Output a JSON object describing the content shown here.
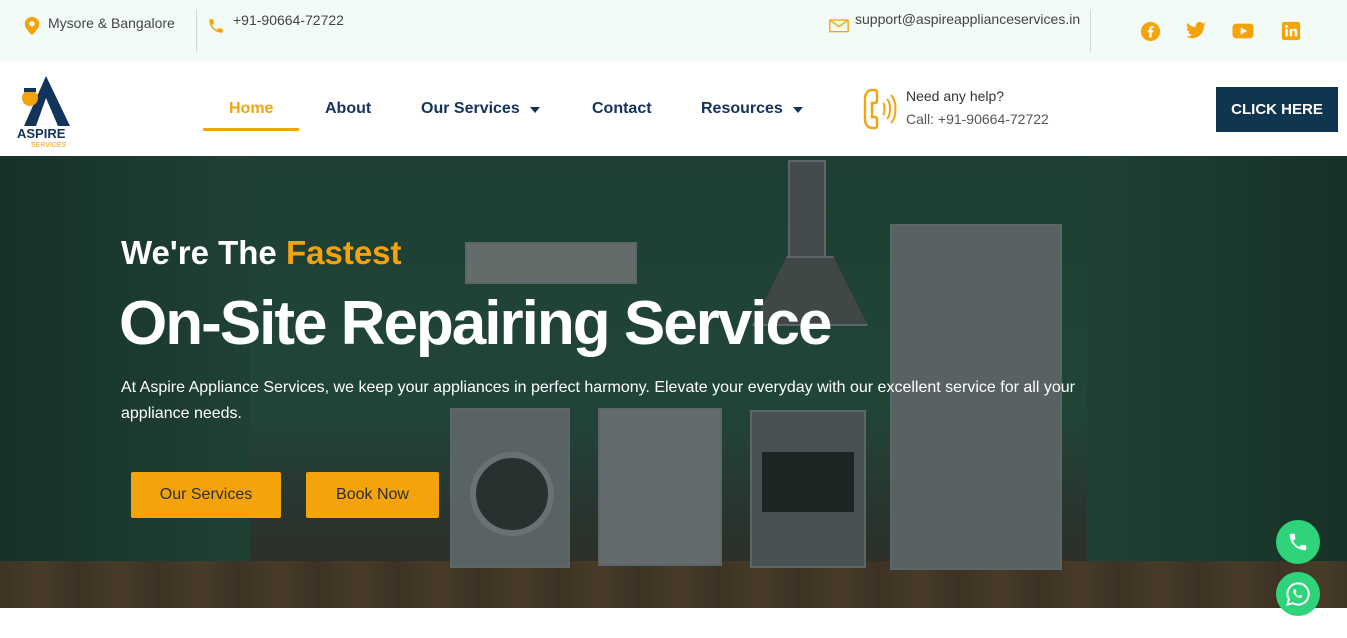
{
  "topbar": {
    "location": "Mysore & Bangalore",
    "phone": "+91-90664-72722",
    "email": "support@aspireapplianceservices.in",
    "social": [
      "facebook-icon",
      "twitter-icon",
      "youtube-icon",
      "linkedin-icon"
    ]
  },
  "logo": {
    "brand": "ASPIRE",
    "tagline": "SERVICES"
  },
  "nav": {
    "items": [
      {
        "label": "Home",
        "active": true
      },
      {
        "label": "About"
      },
      {
        "label": "Our Services",
        "dropdown": true
      },
      {
        "label": "Contact"
      },
      {
        "label": "Resources",
        "dropdown": true
      }
    ]
  },
  "help": {
    "title": "Need any help?",
    "call": "Call: +91-90664-72722"
  },
  "cta_label": "CLICK HERE",
  "hero": {
    "pre_title": "We're The",
    "pre_title_accent": "Fastest",
    "title": "On-Site Repairing Service",
    "description": "At Aspire Appliance Services, we keep your appliances in perfect harmony. Elevate your everyday with our excellent service for all your appliance needs.",
    "buttons": [
      "Our Services",
      "Book Now"
    ]
  },
  "colors": {
    "accent": "#f5a30b",
    "navy": "#12345a",
    "cta_bg": "#0f3550",
    "float_green": "#2ed37a"
  }
}
